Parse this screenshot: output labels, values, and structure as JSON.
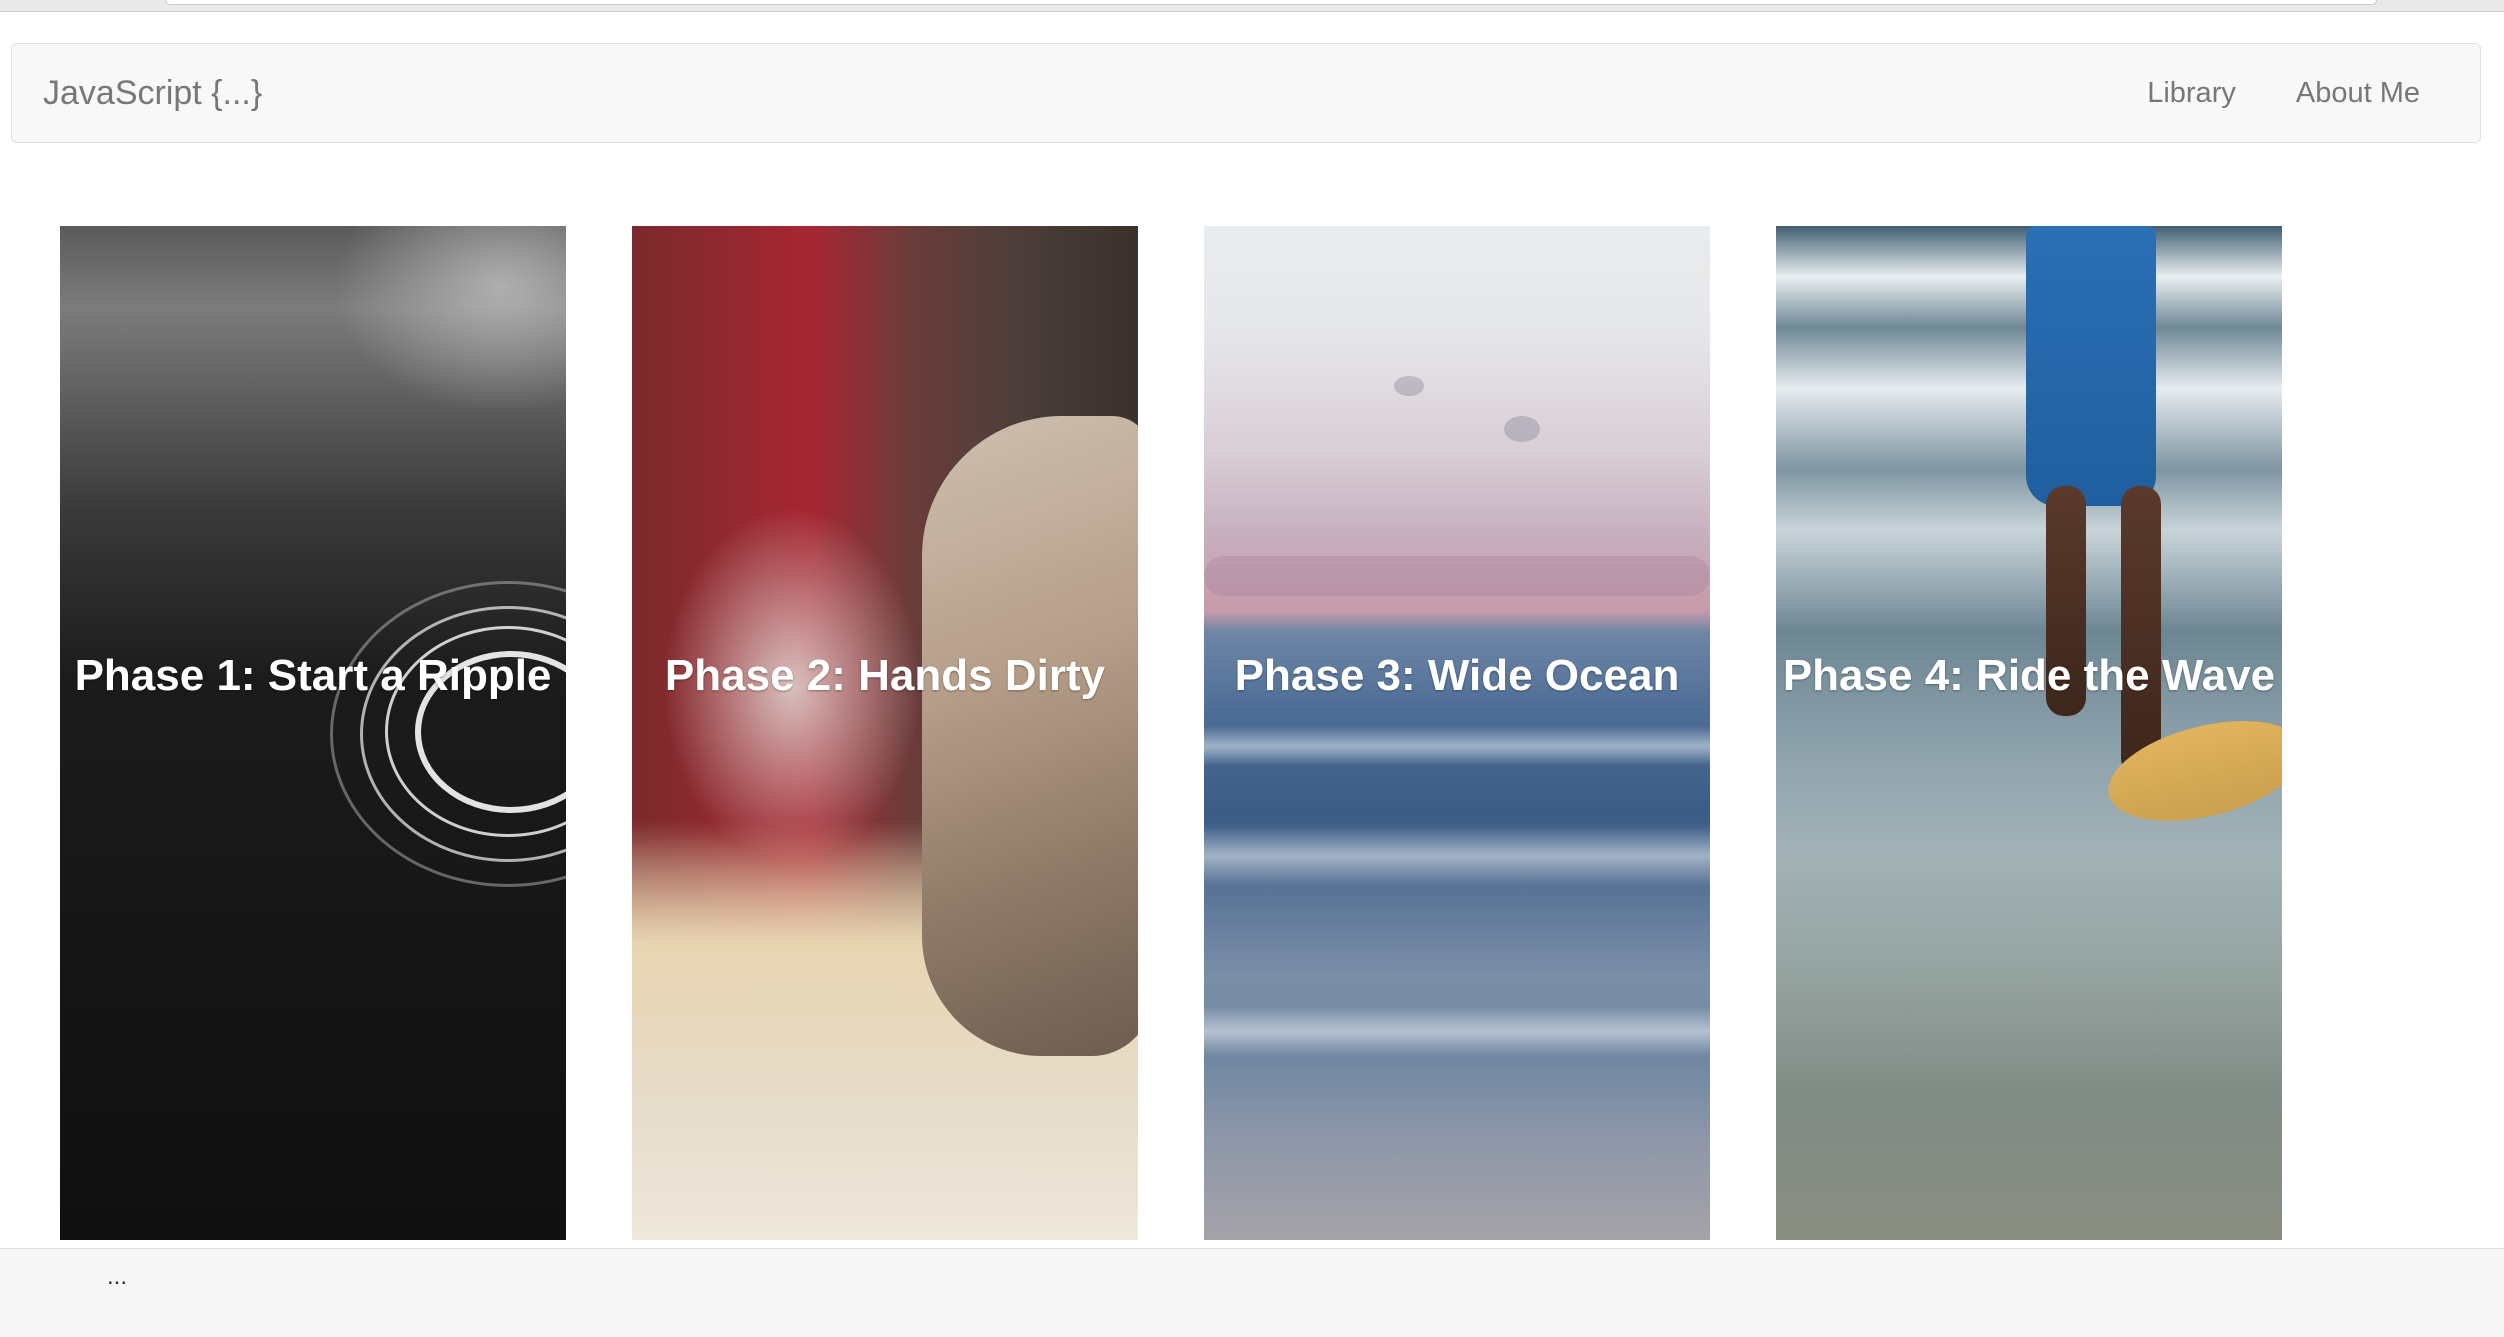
{
  "navbar": {
    "brand": "JavaScript {...}",
    "links": [
      {
        "label": "Library"
      },
      {
        "label": "About Me"
      }
    ]
  },
  "cards": [
    {
      "title": "Phase 1: Start a Ripple",
      "image": "water-ripple-photo"
    },
    {
      "title": "Phase 2: Hands Dirty",
      "image": "clay-hands-photo"
    },
    {
      "title": "Phase 3: Wide Ocean",
      "image": "ocean-sunset-photo"
    },
    {
      "title": "Phase 4: Ride the Wave",
      "image": "skimboard-surfer-photo"
    }
  ],
  "footer": {
    "text": "..."
  }
}
